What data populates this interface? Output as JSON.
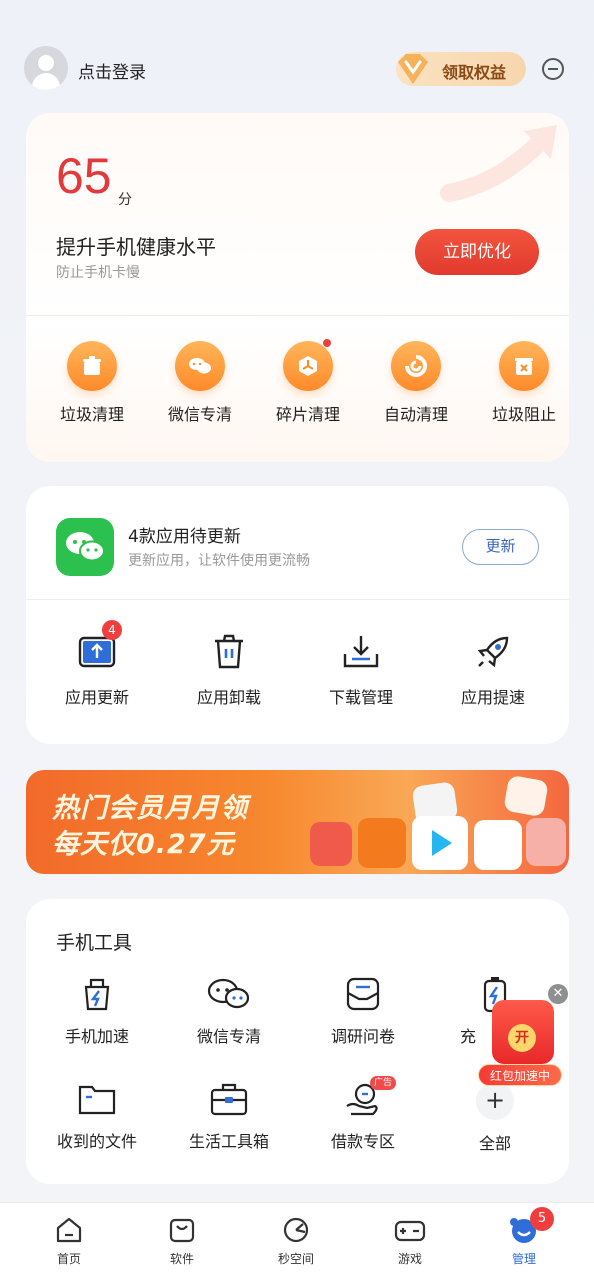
{
  "header": {
    "login_text": "点击登录",
    "vip_text": "领取权益"
  },
  "score_card": {
    "score": "65",
    "score_unit": "分",
    "title": "提升手机健康水平",
    "subtitle": "防止手机卡慢",
    "optimize_button": "立即优化",
    "items": [
      {
        "label": "垃圾清理",
        "icon": "trash-bin-icon"
      },
      {
        "label": "微信专清",
        "icon": "wechat-icon"
      },
      {
        "label": "碎片清理",
        "icon": "fragment-icon",
        "has_dot": true
      },
      {
        "label": "自动清理",
        "icon": "auto-clean-icon"
      },
      {
        "label": "垃圾阻止",
        "icon": "block-trash-icon"
      }
    ]
  },
  "update_card": {
    "title": "4款应用待更新",
    "subtitle": "更新应用，让软件使用更流畅",
    "update_button": "更新",
    "items": [
      {
        "label": "应用更新",
        "icon": "app-update-icon",
        "badge": "4"
      },
      {
        "label": "应用卸载",
        "icon": "uninstall-icon"
      },
      {
        "label": "下载管理",
        "icon": "download-icon"
      },
      {
        "label": "应用提速",
        "icon": "rocket-icon"
      }
    ]
  },
  "banner": {
    "line1": "热门会员月月领",
    "line2": "每天仅0.27元"
  },
  "tools_card": {
    "title": "手机工具",
    "items": [
      {
        "label": "手机加速",
        "icon": "speed-up-icon"
      },
      {
        "label": "微信专清",
        "icon": "wechat-icon"
      },
      {
        "label": "调研问卷",
        "icon": "survey-icon"
      },
      {
        "label": "充",
        "icon": "battery-icon"
      },
      {
        "label": "收到的文件",
        "icon": "folder-icon"
      },
      {
        "label": "生活工具箱",
        "icon": "toolbox-icon"
      },
      {
        "label": "借款专区",
        "icon": "loan-icon",
        "tag": "广告"
      },
      {
        "label": "全部",
        "icon": "plus-icon"
      }
    ]
  },
  "float_packet": {
    "open_text": "开",
    "label": "红包加速中"
  },
  "bottom_nav": {
    "items": [
      {
        "label": "首页",
        "icon": "home-icon"
      },
      {
        "label": "软件",
        "icon": "bag-icon"
      },
      {
        "label": "秒空间",
        "icon": "space-icon"
      },
      {
        "label": "游戏",
        "icon": "gamepad-icon"
      },
      {
        "label": "管理",
        "icon": "manage-icon",
        "badge": "5",
        "active": true
      }
    ]
  },
  "colors": {
    "accent_red": "#e4393c",
    "orange": "#ff8a2a",
    "wechat_green": "#2cc14f",
    "nav_active": "#2f6ed8"
  }
}
